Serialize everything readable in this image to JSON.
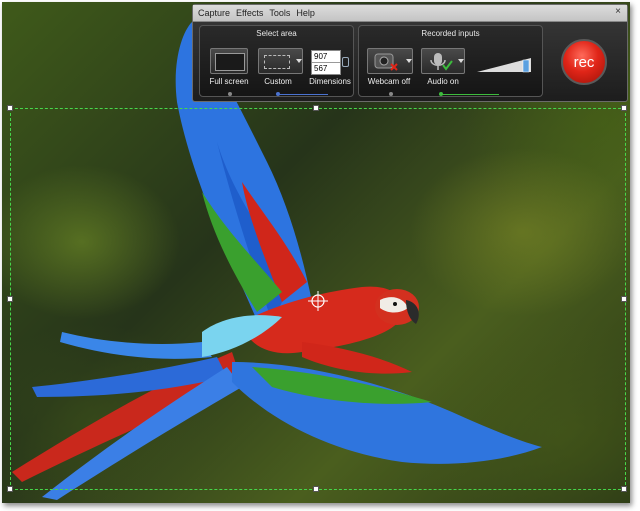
{
  "menu": [
    "Capture",
    "Effects",
    "Tools",
    "Help"
  ],
  "close_label": "×",
  "select_area": {
    "title": "Select area",
    "full_screen_label": "Full screen",
    "custom_label": "Custom",
    "dimensions_label": "Dimensions",
    "width": "907",
    "height": "567"
  },
  "recorded_inputs": {
    "title": "Recorded inputs",
    "webcam_label": "Webcam off",
    "audio_label": "Audio on"
  },
  "rec_label": "rec",
  "colors": {
    "accent_blue": "#4a72d0",
    "accent_green": "#3dbb3d",
    "rec_red": "#e02518",
    "selection_green": "#46d84a"
  }
}
